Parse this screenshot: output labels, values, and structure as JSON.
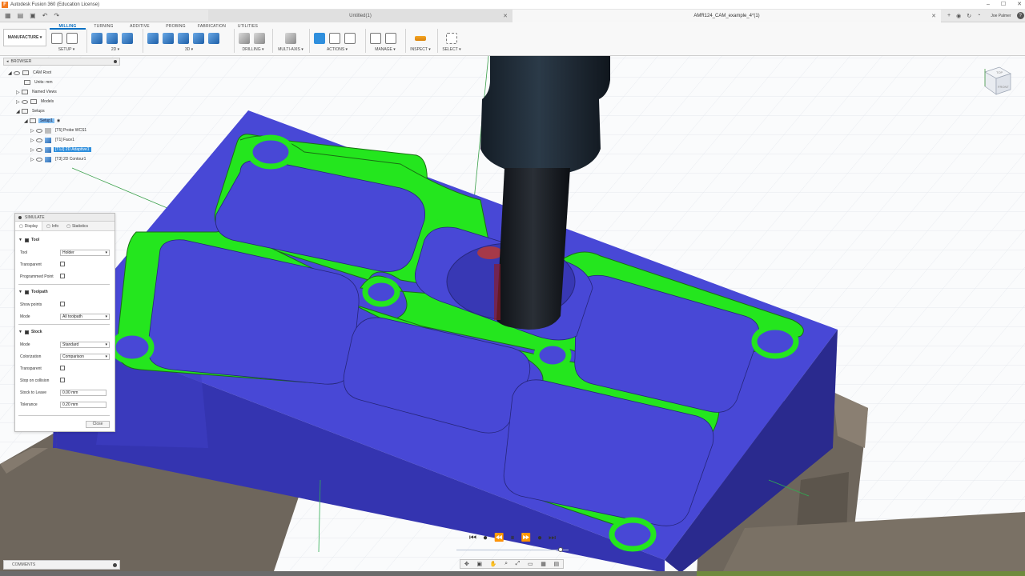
{
  "window": {
    "title": "Autodesk Fusion 360 (Education License)",
    "controls": [
      "–",
      "☐",
      "✕"
    ]
  },
  "tabs": {
    "inactive_doc": "Untitled(1)",
    "active_doc": "AMR124_CAM_example_4*(1)",
    "user": "Joe Palmer",
    "help": "?"
  },
  "ribbon": {
    "workspace": "MANUFACTURE ▾",
    "tabs": [
      "MILLING",
      "TURNING",
      "ADDITIVE",
      "PROBING",
      "FABRICATION",
      "UTILITIES"
    ],
    "groups": {
      "setup": "SETUP ▾",
      "twod": "2D ▾",
      "threed": "3D ▾",
      "drilling": "DRILLING ▾",
      "multiaxis": "MULTI-AXIS ▾",
      "actions": "ACTIONS ▾",
      "manage": "MANAGE ▾",
      "inspect": "INSPECT ▾",
      "select": "SELECT ▾"
    }
  },
  "browser": {
    "title": "BROWSER",
    "root": "CAM Root",
    "units": "Units: mm",
    "named_views": "Named Views",
    "models": "Models",
    "setups": "Setups",
    "setup1": "Setup1",
    "ops": [
      "[T5] Probe WCS1",
      "[T1] Face1",
      "[T12] 2D Adaptive1",
      "[T3] 2D Contour1"
    ]
  },
  "simulate": {
    "title": "SIMULATE",
    "tabs": [
      "Display",
      "Info",
      "Statistics"
    ],
    "tool": {
      "section": "Tool",
      "tool_label": "Tool",
      "tool_value": "Holder",
      "transparent_label": "Transparent",
      "programmed_point_label": "Programmed Point"
    },
    "toolpath": {
      "section": "Toolpath",
      "show_points_label": "Show points",
      "mode_label": "Mode",
      "mode_value": "All toolpath"
    },
    "stock": {
      "section": "Stock",
      "mode_label": "Mode",
      "mode_value": "Standard",
      "colorization_label": "Colorization",
      "colorization_value": "Comparison",
      "transparent_label": "Transparent",
      "stop_label": "Stop on collision",
      "stock_to_leave_label": "Stock to Leave",
      "stock_to_leave_value": "0.00 mm",
      "tolerance_label": "Tolerance",
      "tolerance_value": "0.20 mm"
    },
    "close": "Close"
  },
  "playback": {
    "icons": [
      "⏮",
      "●",
      "⏪",
      "⏸",
      "⏩",
      "●",
      "⏭"
    ],
    "progress": 0.93
  },
  "comments": {
    "label": "COMMENTS"
  },
  "viewcube": {
    "top": "TOP",
    "front": "FRONT"
  },
  "colors": {
    "stock": "#4747d8",
    "machined": "#22e81e",
    "fixture": "#6e665c",
    "tool_holder": "#1a2530",
    "accent": "#0a6fc2"
  }
}
